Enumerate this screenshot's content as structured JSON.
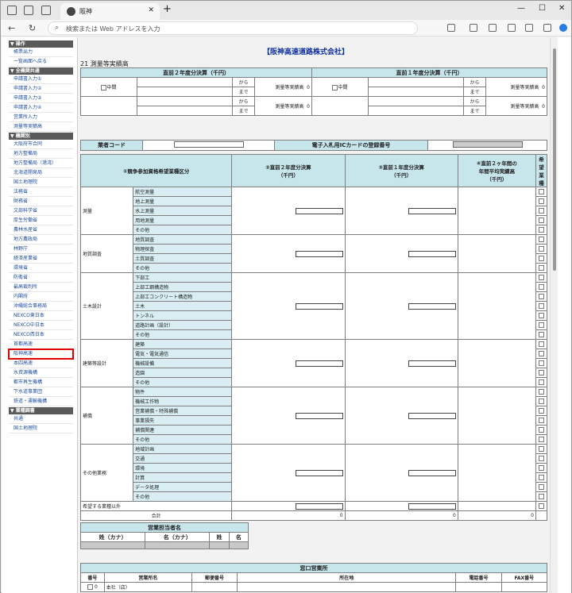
{
  "browser": {
    "tab_title": "阪神",
    "url_placeholder": "検索または Web アドレスを入力",
    "close": "✕",
    "plus": "+"
  },
  "sidebar": [
    {
      "h": "▼ 操作"
    },
    {
      "i": "帳票出力"
    },
    {
      "i": "一覧画面へ戻る"
    },
    {
      "h": "▼ 全機関共通"
    },
    {
      "i": "申請書入力①"
    },
    {
      "i": "申請書入力②"
    },
    {
      "i": "申請書入力③"
    },
    {
      "i": "申請書入力④"
    },
    {
      "i": "営業所入力"
    },
    {
      "i": "測量等実績高"
    },
    {
      "h": "▼ 機関別"
    },
    {
      "i": "大阪府市合同"
    },
    {
      "i": "地方整備局"
    },
    {
      "i": "地方整備局（港湾）"
    },
    {
      "i": "北海道開発局"
    },
    {
      "i": "国土地理院"
    },
    {
      "i": "法務省"
    },
    {
      "i": "財務省"
    },
    {
      "i": "文部科学省"
    },
    {
      "i": "厚生労働省"
    },
    {
      "i": "農林水産省"
    },
    {
      "i": "地方農政局"
    },
    {
      "i": "林野庁"
    },
    {
      "i": "経済産業省"
    },
    {
      "i": "環境省"
    },
    {
      "i": "防衛省"
    },
    {
      "i": "最高裁判所"
    },
    {
      "i": "内閣府"
    },
    {
      "i": "沖縄総合事務局"
    },
    {
      "i": "NEXCO東日本"
    },
    {
      "i": "NEXCO中日本"
    },
    {
      "i": "NEXCO西日本"
    },
    {
      "i": "首都高速"
    },
    {
      "i": "阪神高速",
      "hl": true
    },
    {
      "i": "本四高速"
    },
    {
      "i": "水資源機構"
    },
    {
      "i": "都市再生機構"
    },
    {
      "i": "下水道事業団"
    },
    {
      "i": "鉄道・運輸機構"
    },
    {
      "h": "▼ 業種調書"
    },
    {
      "i": "共通"
    },
    {
      "i": "国土地理院"
    }
  ],
  "company": "【阪神高速道路株式会社】",
  "section": "21 測量等実績高",
  "settlement": {
    "prev2": "直前２年度分決算（千円）",
    "prev1": "直前１年度分決算（千円）",
    "middle": "中間",
    "from": "から",
    "to": "まで",
    "label": "測量等実績高",
    "zero": "0"
  },
  "code_row": {
    "label": "業者コード",
    "ic": "電子入札用ICカードの登録番号"
  },
  "grid": {
    "h1": "①競争参加資格希望業種区分",
    "h2": "②直前２年度分決算\n（千円）",
    "h3": "③直前１年度分決算\n（千円）",
    "h4": "④直前２ヶ年間の\n年間平均実績高\n（千円）",
    "h5": "希望業種",
    "groups": [
      {
        "name": "測量",
        "items": [
          "航空測量",
          "地上測量",
          "水上測量",
          "用地測量",
          "その他"
        ]
      },
      {
        "name": "地質調査",
        "items": [
          "地質調査",
          "物理探査",
          "土質調査",
          "その他"
        ]
      },
      {
        "name": "土木設計",
        "items": [
          "下部工",
          "上部工鋼構造物",
          "上部工コンクリート構造物",
          "土木",
          "トンネル",
          "道路計画（設計）",
          "その他"
        ]
      },
      {
        "name": "建築等設計",
        "items": [
          "建築",
          "電気・電気通信",
          "機械設備",
          "造園",
          "その他"
        ]
      },
      {
        "name": "補償",
        "items": [
          "物件",
          "機械工作物",
          "営業補償・特殊補償",
          "事業損失",
          "補償関連",
          "その他"
        ]
      },
      {
        "name": "その他業務",
        "items": [
          "地域計画",
          "交通",
          "環境",
          "計算",
          "データ処理",
          "その他"
        ]
      }
    ],
    "other": "希望する業種以外",
    "total": "合計",
    "zero": "0"
  },
  "sales_person": {
    "title": "営業担当者名",
    "cols": [
      "姓（カナ）",
      "名（カナ）",
      "姓",
      "名"
    ]
  },
  "office": {
    "title": "窓口営業所",
    "cols": [
      "番号",
      "営業所名",
      "郵便番号",
      "所在地",
      "電話番号",
      "FAX番号"
    ],
    "row": {
      "no": "0",
      "name": "本社（店）"
    }
  }
}
